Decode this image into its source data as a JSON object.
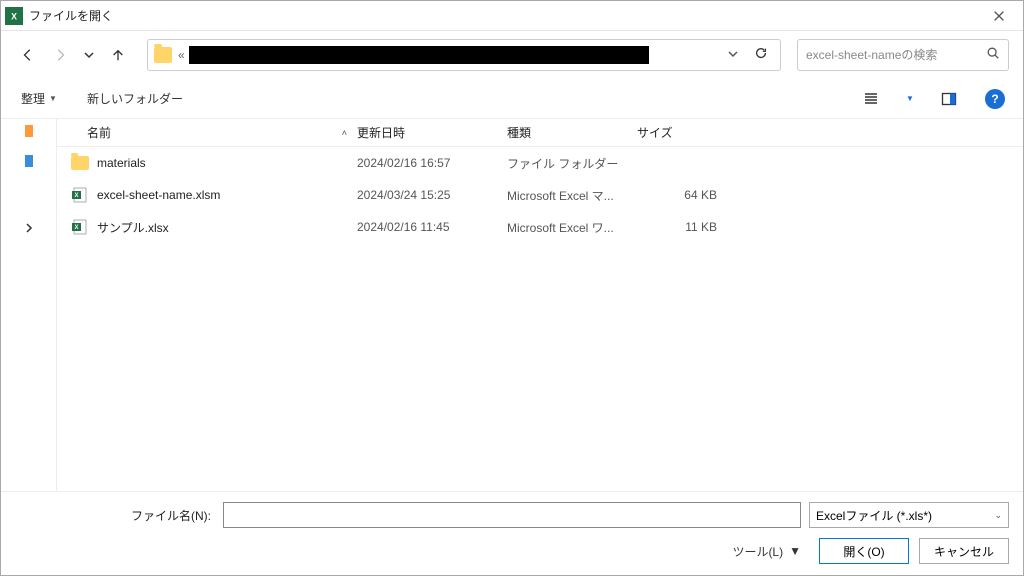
{
  "title": "ファイルを開く",
  "nav": {
    "addr_prefix": "«"
  },
  "search": {
    "placeholder": "excel-sheet-nameの検索"
  },
  "toolbar": {
    "organize": "整理",
    "new_folder": "新しいフォルダー"
  },
  "columns": {
    "name": "名前",
    "date": "更新日時",
    "type": "種類",
    "size": "サイズ"
  },
  "files": [
    {
      "icon": "folder",
      "name": "materials",
      "date": "2024/02/16 16:57",
      "type": "ファイル フォルダー",
      "size": ""
    },
    {
      "icon": "xlsm",
      "name": "excel-sheet-name.xlsm",
      "date": "2024/03/24 15:25",
      "type": "Microsoft Excel マ...",
      "size": "64 KB"
    },
    {
      "icon": "xlsx",
      "name": "サンプル.xlsx",
      "date": "2024/02/16 11:45",
      "type": "Microsoft Excel ワ...",
      "size": "11 KB"
    }
  ],
  "bottom": {
    "filename_label": "ファイル名(N):",
    "filter": "Excelファイル (*.xls*)",
    "tools": "ツール(L)",
    "open": "開く(O)",
    "cancel": "キャンセル"
  }
}
